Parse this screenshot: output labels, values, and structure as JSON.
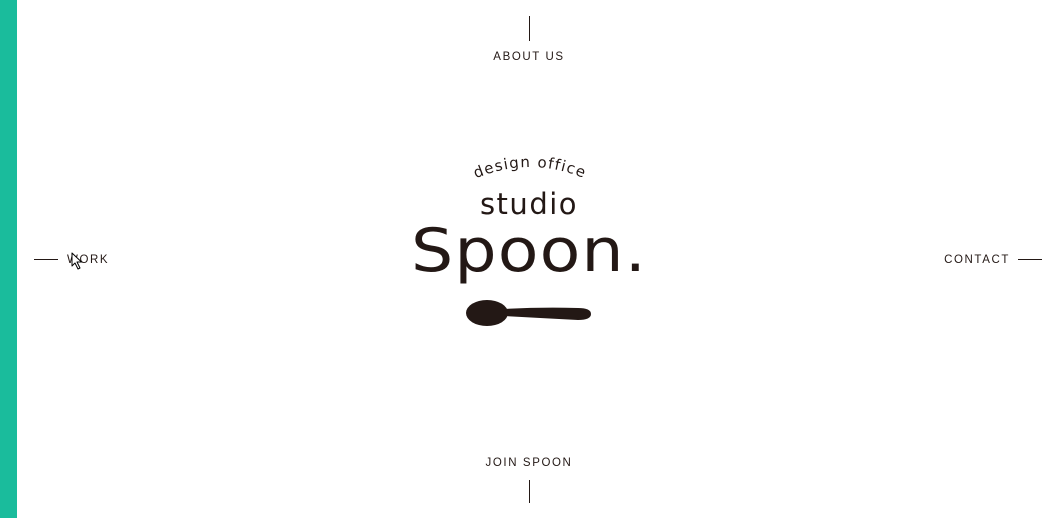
{
  "nav": {
    "top": "ABOUT US",
    "left": "WORK",
    "right": "CONTACT",
    "bottom": "JOIN SPOON"
  },
  "logo": {
    "tagline": "design office",
    "name_top": "studio",
    "name_main": "Spoon."
  },
  "colors": {
    "accent": "#1ABC9C",
    "text": "#231815",
    "background": "#FFFFFF"
  },
  "icons": {
    "logo_mark": "spoon-icon",
    "pointer": "cursor-arrow-icon"
  }
}
